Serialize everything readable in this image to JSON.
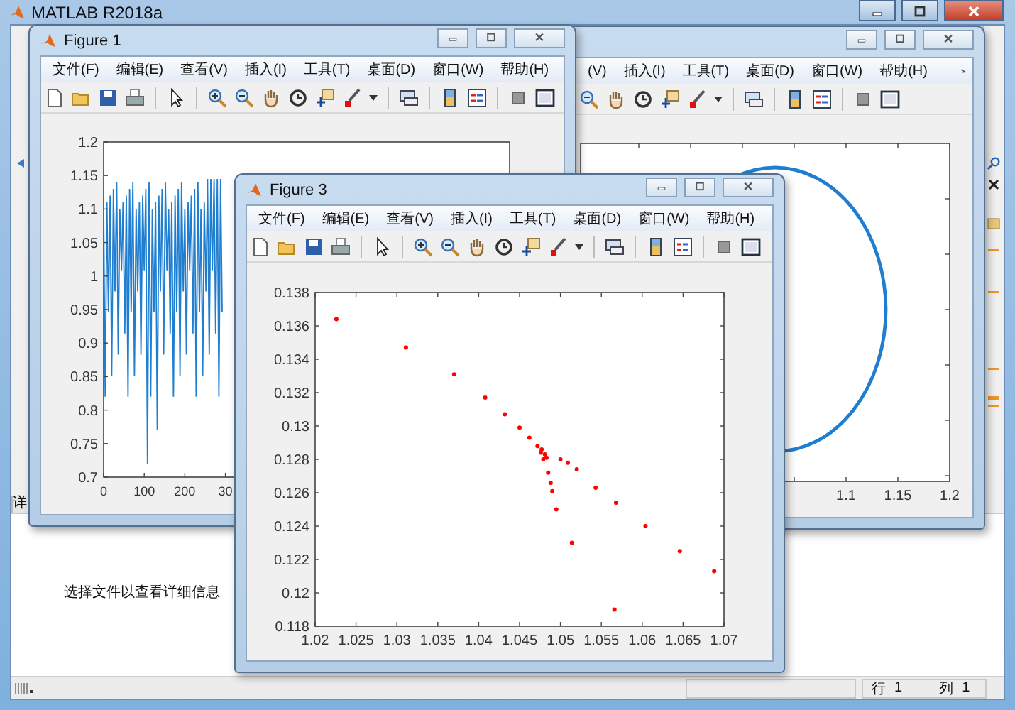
{
  "main_window": {
    "title": "MATLAB R2018a",
    "panel_tab": "详",
    "details_message": "选择文件以查看详细信息",
    "status_bar": {
      "row_label": "行",
      "row_value": "1",
      "column_label": "列",
      "column_value": "1"
    }
  },
  "figures": [
    {
      "title": "Figure 1",
      "menu": [
        "文件(F)",
        "编辑(E)",
        "查看(V)",
        "插入(I)",
        "工具(T)",
        "桌面(D)",
        "窗口(W)",
        "帮助(H)"
      ],
      "y_ticks": [
        "1.2",
        "1.15",
        "1.1",
        "1.05",
        "1",
        "0.95",
        "0.9",
        "0.85",
        "0.8",
        "0.75",
        "0.7"
      ],
      "x_ticks": [
        "0",
        "100",
        "200",
        "30"
      ]
    },
    {
      "menu": [
        "(V)",
        "插入(I)",
        "工具(T)",
        "桌面(D)",
        "窗口(W)",
        "帮助(H)"
      ],
      "x_ticks": [
        "1.1",
        "1.15",
        "1.2"
      ]
    },
    {
      "title": "Figure 3",
      "menu": [
        "文件(F)",
        "编辑(E)",
        "查看(V)",
        "插入(I)",
        "工具(T)",
        "桌面(D)",
        "窗口(W)",
        "帮助(H)"
      ],
      "chart_data": {
        "type": "scatter",
        "xlim": [
          1.02,
          1.07
        ],
        "ylim": [
          0.118,
          0.138
        ],
        "xticks": [
          1.02,
          1.025,
          1.03,
          1.035,
          1.04,
          1.045,
          1.05,
          1.055,
          1.06,
          1.065,
          1.07
        ],
        "yticks": [
          0.118,
          0.12,
          0.122,
          0.124,
          0.126,
          0.128,
          0.13,
          0.132,
          0.134,
          0.136,
          0.138
        ],
        "series": [
          {
            "color": "#ff0000",
            "x": [
              1.0226,
              1.0311,
              1.037,
              1.0408,
              1.0432,
              1.045,
              1.0462,
              1.0472,
              1.0477,
              1.0481,
              1.0483,
              1.0485,
              1.0488,
              1.049,
              1.0495,
              1.0514,
              1.05,
              1.0509,
              1.052,
              1.0543,
              1.0568,
              1.0604,
              1.0646,
              1.0688,
              1.0566,
              1.0479,
              1.0476
            ],
            "values": [
              0.1364,
              0.1347,
              0.1331,
              0.1317,
              0.1307,
              0.1299,
              0.1293,
              0.1288,
              0.1286,
              0.1283,
              0.1281,
              0.1272,
              0.1266,
              0.1261,
              0.125,
              0.123,
              0.128,
              0.1278,
              0.1274,
              0.1263,
              0.1254,
              0.124,
              0.1225,
              0.1213,
              0.119,
              0.128,
              0.1284
            ]
          }
        ]
      }
    }
  ]
}
